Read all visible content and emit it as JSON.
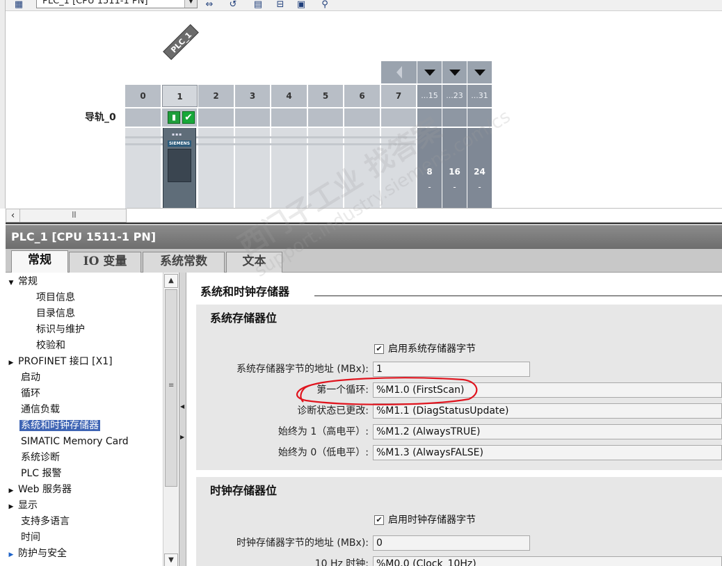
{
  "toolbar": {
    "device_select_value": "PLC_1 [CPU 1511-1 PN]"
  },
  "device_view": {
    "plc_tag": "PLC_1",
    "rail_label": "导轨_0",
    "slot_labels": [
      "0",
      "1",
      "2",
      "3",
      "4",
      "5",
      "6",
      "7"
    ],
    "extension_headers": [
      "...15",
      "...23",
      "...31"
    ],
    "extension_numbers": [
      "8",
      "16",
      "24"
    ],
    "extension_dashes": [
      "-",
      "-",
      "-"
    ],
    "module_brand": "SIEMENS"
  },
  "inspector": {
    "title": "PLC_1 [CPU 1511-1 PN]",
    "tabs": [
      "常规",
      "IO 变量",
      "系统常数",
      "文本"
    ],
    "nav_tree": [
      {
        "label": "常规",
        "arrow": "▼"
      },
      {
        "label": "项目信息"
      },
      {
        "label": "目录信息"
      },
      {
        "label": "标识与维护"
      },
      {
        "label": "校验和"
      },
      {
        "label": "PROFINET 接口 [X1]",
        "arrow": "▶"
      },
      {
        "label": "启动"
      },
      {
        "label": "循环"
      },
      {
        "label": "通信负载"
      },
      {
        "label": "系统和时钟存储器"
      },
      {
        "label": "SIMATIC Memory Card"
      },
      {
        "label": "系统诊断"
      },
      {
        "label": "PLC 报警"
      },
      {
        "label": "Web 服务器",
        "arrow": "▶"
      },
      {
        "label": "显示",
        "arrow": "▶"
      },
      {
        "label": "支持多语言"
      },
      {
        "label": "时间"
      },
      {
        "label": "防护与安全",
        "arrow": "▶"
      }
    ],
    "content": {
      "heading": "系统和时钟存储器",
      "system_memory": {
        "title": "系统存储器位",
        "enable_label": "启用系统存储器字节",
        "address_label": "系统存储器字节的地址 (MBx):",
        "address_value": "1",
        "fields": [
          {
            "label": "第一个循环:",
            "value": "%M1.0 (FirstScan)"
          },
          {
            "label": "诊断状态已更改:",
            "value": "%M1.1 (DiagStatusUpdate)"
          },
          {
            "label": "始终为 1（高电平）:",
            "value": "%M1.2 (AlwaysTRUE)"
          },
          {
            "label": "始终为 0（低电平）:",
            "value": "%M1.3 (AlwaysFALSE)"
          }
        ]
      },
      "clock_memory": {
        "title": "时钟存储器位",
        "enable_label": "启用时钟存储器字节",
        "address_label": "时钟存储器字节的地址 (MBx):",
        "address_value": "0",
        "fields": [
          {
            "label": "10 Hz 时钟:",
            "value": "%M0.0 (Clock_10Hz)"
          }
        ]
      }
    }
  },
  "watermark": {
    "text": "西门子工业 找答案",
    "url": "support.industry.siemens.com/cs"
  },
  "colors": {
    "selected_nav": "#3e64b4",
    "annotation": "#e0141e",
    "status_ok": "#18a83a",
    "extension_slot": "#8e97a3"
  }
}
